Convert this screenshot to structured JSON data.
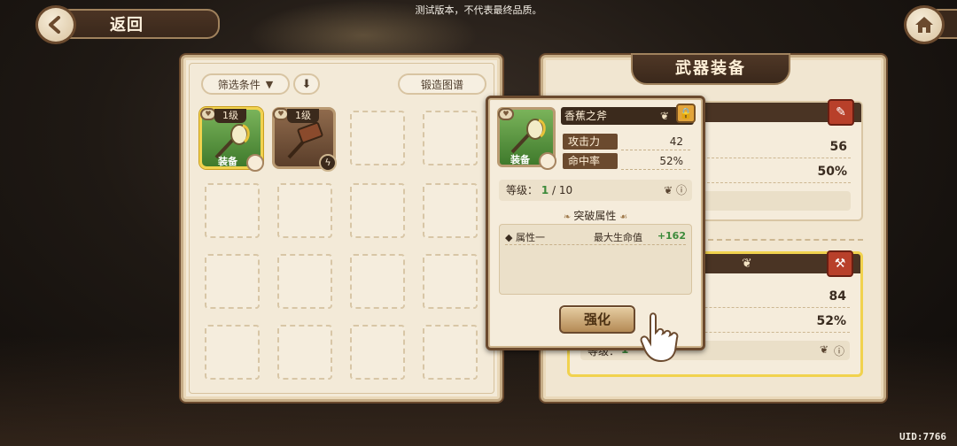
{
  "notice": "测试版本，不代表最终品质。",
  "uid": "UID:7766",
  "header": {
    "back_label": "返回"
  },
  "inventory": {
    "filter_label": "筛选条件",
    "forge_label": "锻造图谱",
    "items": [
      {
        "level": "1级",
        "equipped": true,
        "equip_label": "装备"
      },
      {
        "level": "1级",
        "equipped": false
      }
    ],
    "empty_slots": 14
  },
  "equipment_panel": {
    "title": "武器装备",
    "top_card": {
      "value1": "56",
      "value2": "50%"
    },
    "bottom_card": {
      "value1": "84",
      "value2": "52%",
      "level_prefix": "等级：",
      "level_value": "1"
    }
  },
  "tooltip": {
    "name": "香蕉之斧",
    "equip_label": "装备",
    "stats": [
      {
        "label": "攻击力",
        "value": "42"
      },
      {
        "label": "命中率",
        "value": "52%"
      }
    ],
    "level_label": "等级：",
    "level_current": "1",
    "level_max": "/ 10",
    "section_title": "突破属性",
    "attributes": [
      {
        "key": "属性一",
        "name": "最大生命值",
        "value": "+162"
      }
    ],
    "enhance_label": "强化"
  },
  "colors": {
    "equipped_border": "#f1d24e",
    "value_green": "#3c8a3a",
    "panel_bg": "#f3ead8",
    "dark_bar": "#3b2a1c"
  }
}
